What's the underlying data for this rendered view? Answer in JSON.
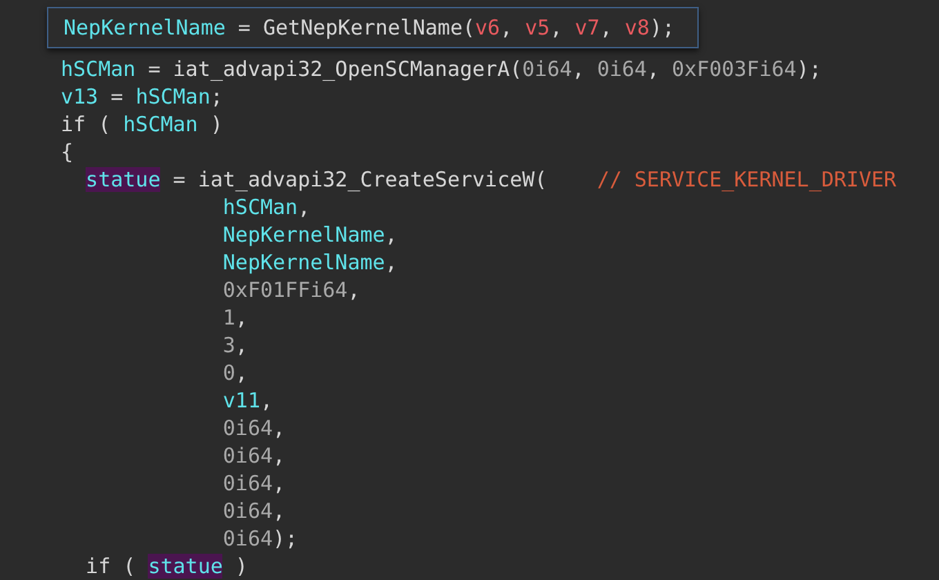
{
  "sticky_line": {
    "tokens": [
      {
        "text": "NepKernelName",
        "kind": "var"
      },
      {
        "text": " = GetNepKernelName(",
        "kind": "plain"
      },
      {
        "text": "v6",
        "kind": "arg"
      },
      {
        "text": ", ",
        "kind": "plain"
      },
      {
        "text": "v5",
        "kind": "arg"
      },
      {
        "text": ", ",
        "kind": "plain"
      },
      {
        "text": "v7",
        "kind": "arg"
      },
      {
        "text": ", ",
        "kind": "plain"
      },
      {
        "text": "v8",
        "kind": "arg"
      },
      {
        "text": ");",
        "kind": "plain"
      }
    ]
  },
  "lines": [
    {
      "kind": "top",
      "tokens": [
        {
          "text": "hSCMan",
          "kind": "var"
        },
        {
          "text": " = iat_advapi32_OpenSCManagerA(",
          "kind": "plain"
        },
        {
          "text": "0i64",
          "kind": "number"
        },
        {
          "text": ", ",
          "kind": "plain"
        },
        {
          "text": "0i64",
          "kind": "number"
        },
        {
          "text": ", ",
          "kind": "plain"
        },
        {
          "text": "0xF003Fi64",
          "kind": "number"
        },
        {
          "text": ");",
          "kind": "plain"
        }
      ]
    },
    {
      "kind": "top",
      "tokens": [
        {
          "text": "v13",
          "kind": "var"
        },
        {
          "text": " = ",
          "kind": "plain"
        },
        {
          "text": "hSCMan",
          "kind": "var"
        },
        {
          "text": ";",
          "kind": "plain"
        }
      ]
    },
    {
      "kind": "top",
      "tokens": [
        {
          "text": "if ( ",
          "kind": "plain"
        },
        {
          "text": "hSCMan",
          "kind": "var"
        },
        {
          "text": " )",
          "kind": "plain"
        }
      ]
    },
    {
      "kind": "top",
      "tokens": [
        {
          "text": "{",
          "kind": "plain"
        }
      ]
    },
    {
      "kind": "nested",
      "tokens": [
        {
          "text": "statue",
          "kind": "var",
          "highlighted": true
        },
        {
          "text": " = iat_advapi32_CreateServiceW(    ",
          "kind": "plain"
        },
        {
          "text": "// SERVICE_KERNEL_DRIVER",
          "kind": "comment"
        }
      ]
    },
    {
      "kind": "argument",
      "tokens": [
        {
          "text": "hSCMan",
          "kind": "var"
        },
        {
          "text": ",",
          "kind": "plain"
        }
      ]
    },
    {
      "kind": "argument",
      "tokens": [
        {
          "text": "NepKernelName",
          "kind": "var"
        },
        {
          "text": ",",
          "kind": "plain"
        }
      ]
    },
    {
      "kind": "argument",
      "tokens": [
        {
          "text": "NepKernelName",
          "kind": "var"
        },
        {
          "text": ",",
          "kind": "plain"
        }
      ]
    },
    {
      "kind": "argument",
      "tokens": [
        {
          "text": "0xF01FFi64",
          "kind": "number"
        },
        {
          "text": ",",
          "kind": "plain"
        }
      ]
    },
    {
      "kind": "argument",
      "tokens": [
        {
          "text": "1",
          "kind": "number"
        },
        {
          "text": ",",
          "kind": "plain"
        }
      ]
    },
    {
      "kind": "argument",
      "tokens": [
        {
          "text": "3",
          "kind": "number"
        },
        {
          "text": ",",
          "kind": "plain"
        }
      ]
    },
    {
      "kind": "argument",
      "tokens": [
        {
          "text": "0",
          "kind": "number"
        },
        {
          "text": ",",
          "kind": "plain"
        }
      ]
    },
    {
      "kind": "argument",
      "tokens": [
        {
          "text": "v11",
          "kind": "var"
        },
        {
          "text": ",",
          "kind": "plain"
        }
      ]
    },
    {
      "kind": "argument",
      "tokens": [
        {
          "text": "0i64",
          "kind": "number"
        },
        {
          "text": ",",
          "kind": "plain"
        }
      ]
    },
    {
      "kind": "argument",
      "tokens": [
        {
          "text": "0i64",
          "kind": "number"
        },
        {
          "text": ",",
          "kind": "plain"
        }
      ]
    },
    {
      "kind": "argument",
      "tokens": [
        {
          "text": "0i64",
          "kind": "number"
        },
        {
          "text": ",",
          "kind": "plain"
        }
      ]
    },
    {
      "kind": "argument",
      "tokens": [
        {
          "text": "0i64",
          "kind": "number"
        },
        {
          "text": ",",
          "kind": "plain"
        }
      ]
    },
    {
      "kind": "argument",
      "tokens": [
        {
          "text": "0i64",
          "kind": "number"
        },
        {
          "text": ");",
          "kind": "plain"
        }
      ]
    },
    {
      "kind": "nested",
      "tokens": [
        {
          "text": "if ( ",
          "kind": "plain"
        },
        {
          "text": "statue",
          "kind": "var",
          "highlighted": true
        },
        {
          "text": " )",
          "kind": "plain"
        }
      ]
    }
  ]
}
